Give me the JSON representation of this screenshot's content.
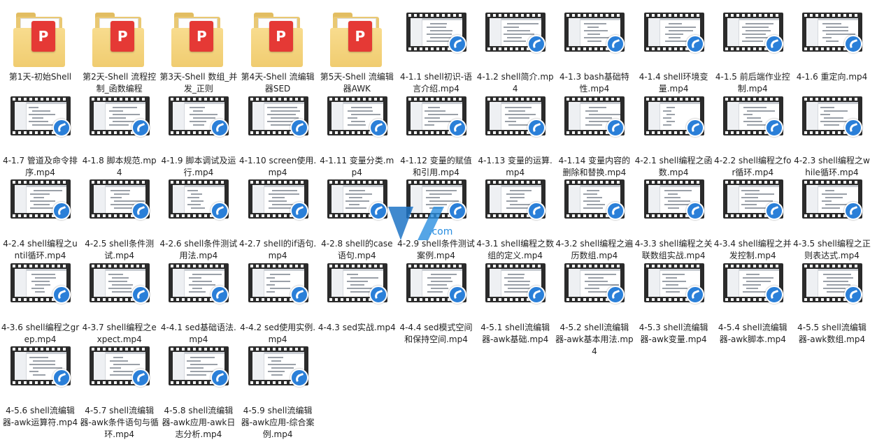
{
  "watermark_text": ".com",
  "items": [
    {
      "type": "folder",
      "label": "第1天-初始Shell"
    },
    {
      "type": "folder",
      "label": "第2天-Shell 流程控制_函数编程"
    },
    {
      "type": "folder",
      "label": "第3天-Shell 数组_并发_正则"
    },
    {
      "type": "folder",
      "label": "第4天-Shell 流编辑器SED"
    },
    {
      "type": "folder",
      "label": "第5天-Shell 流编辑器AWK"
    },
    {
      "type": "video",
      "label": "4-1.1 shell初识-语言介绍.mp4"
    },
    {
      "type": "video",
      "label": "4-1.2 shell简介.mp4"
    },
    {
      "type": "video",
      "label": "4-1.3 bash基础特性.mp4"
    },
    {
      "type": "video",
      "label": "4-1.4 shell环境变量.mp4"
    },
    {
      "type": "video",
      "label": "4-1.5 前后端作业控制.mp4"
    },
    {
      "type": "video",
      "label": "4-1.6 重定向.mp4"
    },
    {
      "type": "video",
      "label": "4-1.7 管道及命令排序.mp4"
    },
    {
      "type": "video",
      "label": "4-1.8 脚本规范.mp4"
    },
    {
      "type": "video",
      "label": "4-1.9 脚本调试及运行.mp4"
    },
    {
      "type": "video",
      "label": "4-1.10 screen使用.mp4"
    },
    {
      "type": "video",
      "label": "4-1.11 变量分类.mp4"
    },
    {
      "type": "video",
      "label": "4-1.12 变量的赋值和引用.mp4"
    },
    {
      "type": "video",
      "label": "4-1.13 变量的运算.mp4"
    },
    {
      "type": "video",
      "label": "4-1.14 变量内容的删除和替换.mp4"
    },
    {
      "type": "video",
      "label": "4-2.1 shell编程之函数.mp4"
    },
    {
      "type": "video",
      "label": "4-2.2 shell编程之for循环.mp4"
    },
    {
      "type": "video",
      "label": "4-2.3 shell编程之while循环.mp4"
    },
    {
      "type": "video",
      "label": "4-2.4 shell编程之until循环.mp4"
    },
    {
      "type": "video",
      "label": "4-2.5 shell条件测试.mp4"
    },
    {
      "type": "video",
      "label": "4-2.6 shell条件测试用法.mp4"
    },
    {
      "type": "video",
      "label": "4-2.7 shell的if语句.mp4"
    },
    {
      "type": "video",
      "label": "4-2.8 shell的case语句.mp4"
    },
    {
      "type": "video",
      "label": "4-2.9 shell条件测试案例.mp4"
    },
    {
      "type": "video",
      "label": "4-3.1 shell编程之数组的定义.mp4"
    },
    {
      "type": "video",
      "label": "4-3.2 shell编程之遍历数组.mp4"
    },
    {
      "type": "video",
      "label": "4-3.3 shell编程之关联数组实战.mp4"
    },
    {
      "type": "video",
      "label": "4-3.4 shell编程之并发控制.mp4"
    },
    {
      "type": "video",
      "label": "4-3.5 shell编程之正则表达式.mp4"
    },
    {
      "type": "video",
      "label": "4-3.6 shell编程之grep.mp4"
    },
    {
      "type": "video",
      "label": "4-3.7 shell编程之expect.mp4"
    },
    {
      "type": "video",
      "label": "4-4.1 sed基础语法.mp4"
    },
    {
      "type": "video",
      "label": "4-4.2 sed使用实例.mp4"
    },
    {
      "type": "video",
      "label": "4-4.3 sed实战.mp4"
    },
    {
      "type": "video",
      "label": "4-4.4 sed模式空间和保持空间.mp4"
    },
    {
      "type": "video",
      "label": "4-5.1 shell流编辑器-awk基础.mp4"
    },
    {
      "type": "video",
      "label": "4-5.2 shell流编辑器-awk基本用法.mp4"
    },
    {
      "type": "video",
      "label": "4-5.3 shell流编辑器-awk变量.mp4"
    },
    {
      "type": "video",
      "label": "4-5.4 shell流编辑器-awk脚本.mp4"
    },
    {
      "type": "video",
      "label": "4-5.5 shell流编辑器-awk数组.mp4"
    },
    {
      "type": "video",
      "label": "4-5.6 shell流编辑器-awk运算符.mp4"
    },
    {
      "type": "video",
      "label": "4-5.7 shell流编辑器-awk条件语句与循环.mp4"
    },
    {
      "type": "video",
      "label": "4-5.8 shell流编辑器-awk应用-awk日志分析.mp4"
    },
    {
      "type": "video",
      "label": "4-5.9 shell流编辑器-awk应用-综合案例.mp4"
    }
  ]
}
